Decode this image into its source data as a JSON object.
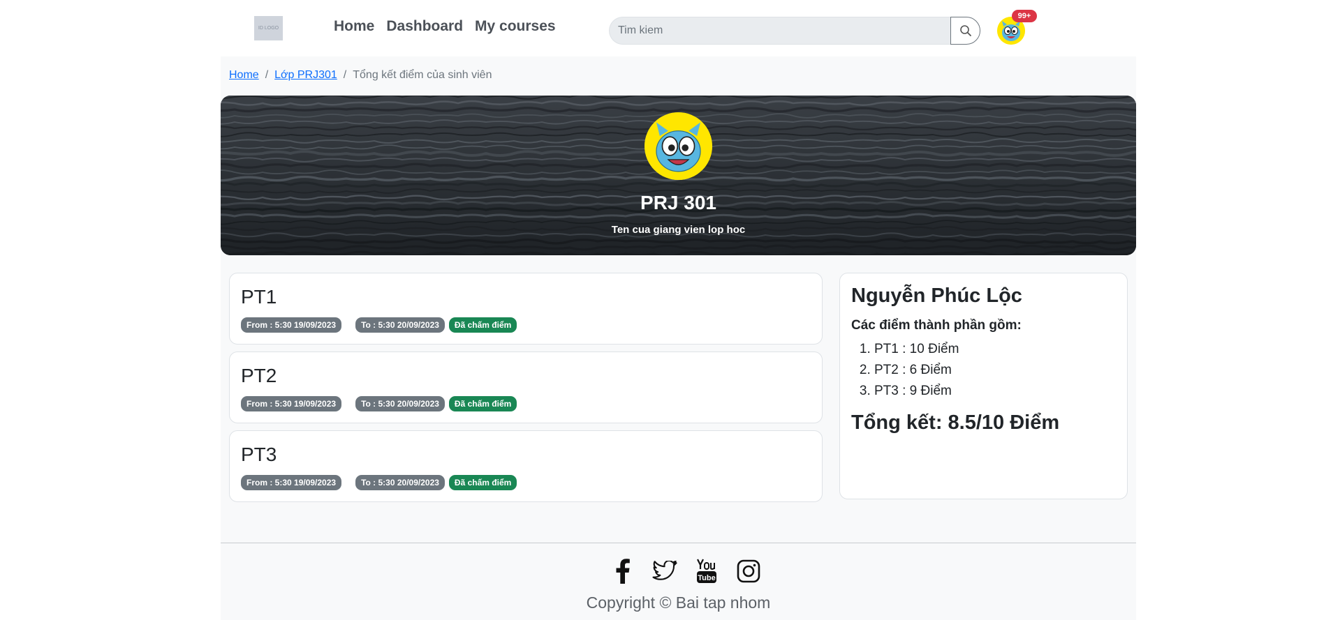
{
  "nav": {
    "logo_text": "ID LOGO",
    "links": [
      "Home",
      "Dashboard",
      "My courses"
    ],
    "search_placeholder": "Tim kiem",
    "notification_count": "99+"
  },
  "breadcrumb": {
    "items": [
      "Home",
      "Lớp PRJ301"
    ],
    "current": "Tổng kết điểm của sinh viên",
    "separator": "/"
  },
  "banner": {
    "title": "PRJ 301",
    "subtitle": "Ten cua giang vien lop hoc"
  },
  "assessments": [
    {
      "title": "PT1",
      "from": "From : 5:30 19/09/2023",
      "to": "To : 5:30 20/09/2023",
      "status": "Đã chấm điểm"
    },
    {
      "title": "PT2",
      "from": "From : 5:30 19/09/2023",
      "to": "To : 5:30 20/09/2023",
      "status": "Đã chấm điểm"
    },
    {
      "title": "PT3",
      "from": "From : 5:30 19/09/2023",
      "to": "To : 5:30 20/09/2023",
      "status": "Đã chấm điểm"
    }
  ],
  "summary": {
    "student_name": "Nguyễn Phúc Lộc",
    "components_label": "Các điểm thành phần gồm:",
    "grades": [
      "PT1 : 10 Điểm",
      "PT2 : 6 Điểm",
      "PT3 : 9 Điểm"
    ],
    "total": "Tổng kết: 8.5/10 Điểm"
  },
  "footer": {
    "socials": [
      "facebook-icon",
      "twitter-icon",
      "youtube-icon",
      "instagram-icon"
    ],
    "copyright": "Copyright © Bai tap nhom"
  },
  "colors": {
    "badge_grey": "#6c757d",
    "badge_green": "#198754",
    "notification_red": "#dc3545",
    "link_blue": "#0d6efd"
  }
}
